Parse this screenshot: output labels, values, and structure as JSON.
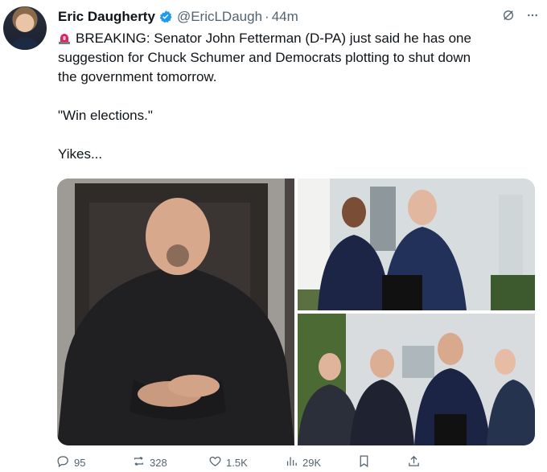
{
  "tweet": {
    "author_name": "Eric Daugherty",
    "handle": "@EricLDaugh",
    "separator": "·",
    "time": "44m",
    "text_line1": "BREAKING: Senator John Fetterman (D-PA) just said he has one",
    "text_line2": "suggestion for Chuck Schumer and Democrats plotting to shut down",
    "text_line3": "the government tomorrow.",
    "quote": "\"Win elections.\"",
    "closing": "Yikes..."
  },
  "metrics": {
    "replies": "95",
    "retweets": "328",
    "likes": "1.5K",
    "views": "29K"
  },
  "colors": {
    "verified": "#1d9bf0",
    "siren": "#e0245e",
    "muted": "#536471",
    "text": "#0f1419"
  },
  "icons": [
    "verified-badge-icon",
    "grok-icon",
    "more-icon",
    "siren-emoji-icon",
    "reply-icon",
    "retweet-icon",
    "like-icon",
    "views-icon",
    "bookmark-icon",
    "share-icon"
  ]
}
